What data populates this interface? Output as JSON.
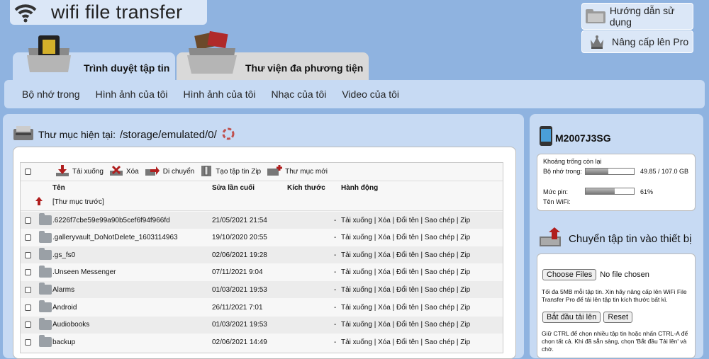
{
  "header": {
    "title": "wifi file transfer",
    "help_label": "Hướng dẫn sử dụng",
    "upgrade_label": "Nâng cấp lên Pro"
  },
  "tabs": [
    {
      "label": "Trình duyệt tập tin"
    },
    {
      "label": "Thư viện đa phương tiện"
    }
  ],
  "nav": [
    "Bộ nhớ trong",
    "Hình ảnh của tôi",
    "Hình ảnh của tôi",
    "Nhạc của tôi",
    "Video của tôi"
  ],
  "browser": {
    "current_dir_label": "Thư mục hiện tại:",
    "current_dir": "/storage/emulated/0/",
    "toolbar": {
      "download": "Tải xuống",
      "delete": "Xóa",
      "move": "Di chuyển",
      "zip": "Tạo tập tin Zip",
      "new_folder": "Thư mục mới"
    },
    "columns": [
      "Tên",
      "Sửa lần cuối",
      "Kích thước",
      "Hành động"
    ],
    "parent_label": "[Thư mục trước]",
    "actions": "Tải xuống | Xóa | Đổi tên | Sao chép | Zip",
    "rows": [
      {
        "name": ".6226f7cbe59e99a90b5cef6f94f966fd",
        "modified": "21/05/2021 21:54",
        "size": "-"
      },
      {
        "name": ".galleryvault_DoNotDelete_1603114963",
        "modified": "19/10/2020 20:55",
        "size": "-"
      },
      {
        "name": ".gs_fs0",
        "modified": "02/06/2021 19:28",
        "size": "-"
      },
      {
        "name": ".Unseen Messenger",
        "modified": "07/11/2021 9:04",
        "size": "-"
      },
      {
        "name": "Alarms",
        "modified": "01/03/2021 19:53",
        "size": "-"
      },
      {
        "name": "Android",
        "modified": "26/11/2021 7:01",
        "size": "-"
      },
      {
        "name": "Audiobooks",
        "modified": "01/03/2021 19:53",
        "size": "-"
      },
      {
        "name": "backup",
        "modified": "02/06/2021 14:49",
        "size": "-"
      }
    ]
  },
  "device": {
    "name": "M2007J3SG",
    "space_title": "Khoảng trống còn lại",
    "storage_label": "Bộ nhớ trong:",
    "storage_value": "49.85 / 107.0 GB",
    "storage_fraction": 0.47,
    "battery_label": "Mức pin:",
    "battery_value": "61%",
    "battery_fraction": 0.61,
    "wifi_label": "Tên WiFi:"
  },
  "upload": {
    "title": "Chuyển tập tin vào thiết bị",
    "choose_label": "Choose Files",
    "no_file": "No file chosen",
    "limit_note": "Tối đa 5MB mỗi tập tin. Xin hãy nâng cấp lên WiFi File Transfer Pro để tải lên tập tin kích thước bất kì.",
    "start_label": "Bắt đầu tải lên",
    "reset_label": "Reset",
    "hint": "Giữ CTRL để chọn nhiều tập tin hoặc nhấn CTRL-A để chọn tất cả. Khi đã sẵn sàng, chọn 'Bắt đầu Tải lên' và chờ."
  },
  "colors": {
    "background": "#8fb3e0",
    "panel": "#c7daf3",
    "accent": "#b01e1e"
  }
}
